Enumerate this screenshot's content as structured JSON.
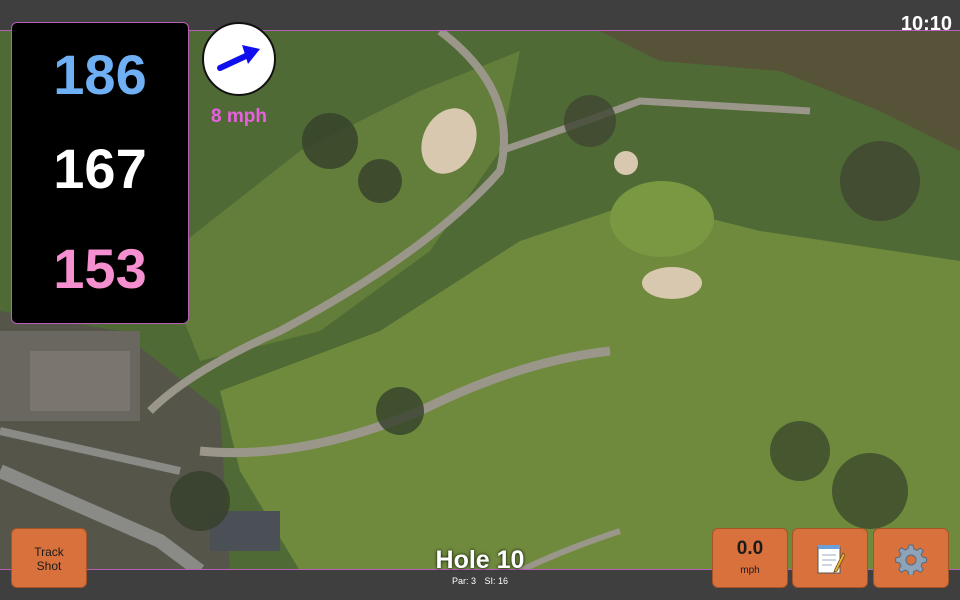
{
  "status": {
    "time": "10:10"
  },
  "distances": {
    "back": "186",
    "middle": "167",
    "front": "153"
  },
  "wind": {
    "speed": "8 mph",
    "direction_icon": "arrow-icon"
  },
  "hole": {
    "title": "Hole 10",
    "par": "Par: 3",
    "si": "SI: 16"
  },
  "buttons": {
    "track_shot_line1": "Track",
    "track_shot_line2": "Shot",
    "speed_value": "0.0",
    "speed_unit": "mph",
    "notes_icon": "notepad-icon",
    "settings_icon": "gear-icon"
  },
  "colors": {
    "back": "#6fb0f5",
    "middle": "#ffffff",
    "front": "#f58fd0",
    "wind": "#e860e0",
    "button": "#d9713c",
    "accent_border": "#b85fb8"
  }
}
